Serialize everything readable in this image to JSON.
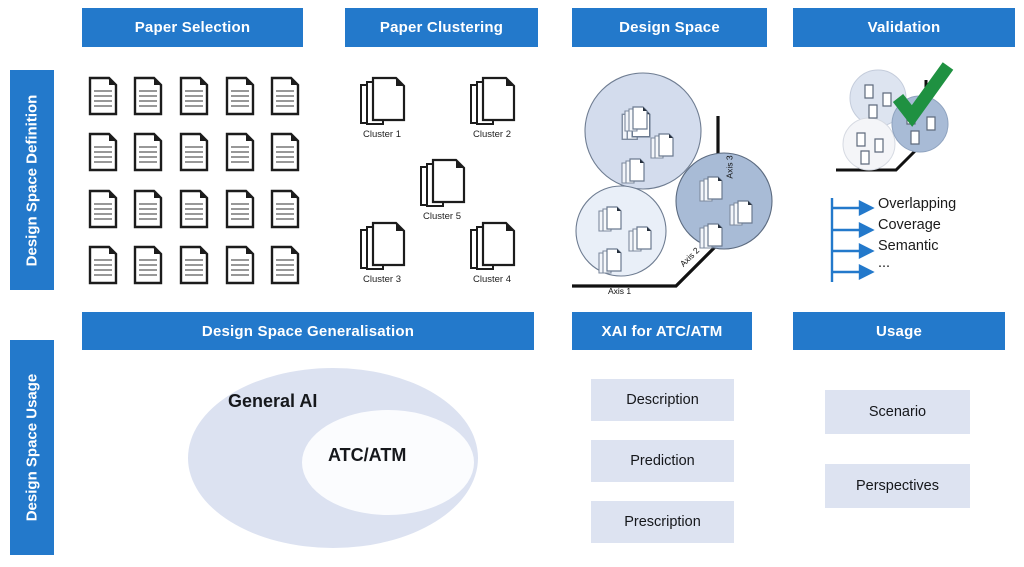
{
  "theme": {
    "accent": "#2379cb",
    "panel_light": "#dde3f1",
    "check_green": "#1f9141",
    "doc_line": "#8a8a8a"
  },
  "sidebar": {
    "items": [
      {
        "label": "Design Space Definition",
        "name": "design-space-definition"
      },
      {
        "label": "Design Space Usage",
        "name": "design-space-usage"
      }
    ]
  },
  "row1": {
    "headers": [
      {
        "label": "Paper Selection"
      },
      {
        "label": "Paper Clustering"
      },
      {
        "label": "Design Space"
      },
      {
        "label": "Validation"
      }
    ]
  },
  "row2": {
    "headers": [
      {
        "label": "Design Space Generalisation"
      },
      {
        "label": "XAI for ATC/ATM"
      },
      {
        "label": "Usage"
      }
    ]
  },
  "paper_selection": {
    "rows": 4,
    "columns": 5,
    "document_count": 20,
    "icon": "document-icon"
  },
  "paper_clustering": {
    "clusters": [
      {
        "label": "Cluster 1"
      },
      {
        "label": "Cluster 2"
      },
      {
        "label": "Cluster 5"
      },
      {
        "label": "Cluster 3"
      },
      {
        "label": "Cluster 4"
      }
    ]
  },
  "design_space": {
    "axes": [
      {
        "label": "Axis 1"
      },
      {
        "label": "Axis 2"
      },
      {
        "label": "Axis 3"
      }
    ],
    "clusters": [
      {
        "name": "cluster-bubble-top-left",
        "fill": "#d3dced",
        "docs": 3
      },
      {
        "name": "cluster-bubble-bottom-left",
        "fill": "#e9eff8",
        "docs": 3
      },
      {
        "name": "cluster-bubble-right",
        "fill": "#a8bbd6",
        "docs": 3
      }
    ]
  },
  "validation": {
    "check_icon": "check-mark-icon",
    "bubbles": [
      {
        "name": "validation-bubble-1",
        "fill": "#dde4f0"
      },
      {
        "name": "validation-bubble-2",
        "fill": "#f4f5f8"
      },
      {
        "name": "validation-bubble-3",
        "fill": "#a8bbd6"
      }
    ],
    "criteria": [
      {
        "label": "Overlapping"
      },
      {
        "label": "Coverage"
      },
      {
        "label": "Semantic"
      },
      {
        "label": "..."
      }
    ]
  },
  "generalisation": {
    "outer_label": "General AI",
    "inner_label": "ATC/ATM"
  },
  "xai": {
    "boxes": [
      {
        "label": "Description"
      },
      {
        "label": "Prediction"
      },
      {
        "label": "Prescription"
      }
    ]
  },
  "usage": {
    "boxes": [
      {
        "label": "Scenario"
      },
      {
        "label": "Perspectives"
      }
    ]
  }
}
